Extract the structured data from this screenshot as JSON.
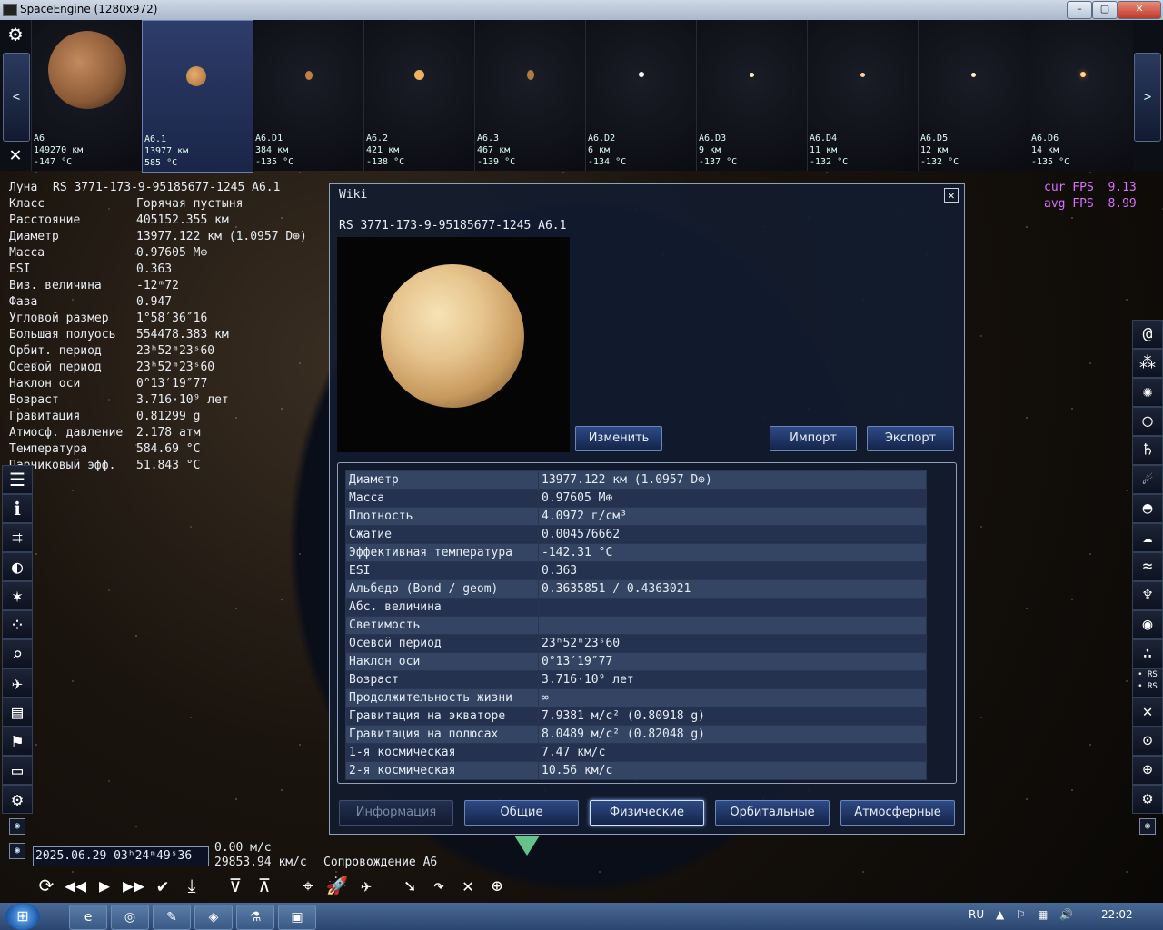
{
  "window": {
    "title": "SpaceEngine (1280x972)",
    "min": "–",
    "max": "▢",
    "close": "✕"
  },
  "strip": {
    "prev": "<",
    "next": ">",
    "thumbs": [
      {
        "name": "A6",
        "size": "149270 км",
        "temp": "-147 °C"
      },
      {
        "name": "A6.1",
        "size": "13977 км",
        "temp": "585 °C"
      },
      {
        "name": "A6.D1",
        "size": "384 км",
        "temp": "-135 °C"
      },
      {
        "name": "A6.2",
        "size": "421 км",
        "temp": "-138 °C"
      },
      {
        "name": "A6.3",
        "size": "467 км",
        "temp": "-139 °C"
      },
      {
        "name": "A6.D2",
        "size": "6 км",
        "temp": "-134 °C"
      },
      {
        "name": "A6.D3",
        "size": "9 км",
        "temp": "-137 °C"
      },
      {
        "name": "A6.D4",
        "size": "11 км",
        "temp": "-132 °C"
      },
      {
        "name": "A6.D5",
        "size": "12 км",
        "temp": "-132 °C"
      },
      {
        "name": "A6.D6",
        "size": "14 км",
        "temp": "-135 °C"
      }
    ]
  },
  "info": [
    {
      "k": "Луна",
      "v": "RS 3771-173-9-95185677-1245 A6.1"
    },
    {
      "k": "Класс",
      "v": "Горячая пустыня"
    },
    {
      "k": "Расстояние",
      "v": "405152.355 км"
    },
    {
      "k": "Диаметр",
      "v": "13977.122 км (1.0957 D⊕)"
    },
    {
      "k": "Масса",
      "v": "0.97605 M⊕"
    },
    {
      "k": "ESI",
      "v": "0.363"
    },
    {
      "k": "Виз. величина",
      "v": "-12ᵐ72"
    },
    {
      "k": "Фаза",
      "v": "0.947"
    },
    {
      "k": "Угловой размер",
      "v": "1°58′36″16"
    },
    {
      "k": "Большая полуось",
      "v": "554478.383 км"
    },
    {
      "k": "Орбит. период",
      "v": "23ʰ52ᵐ23ˢ60"
    },
    {
      "k": "Осевой период",
      "v": "23ʰ52ᵐ23ˢ60"
    },
    {
      "k": "Наклон оси",
      "v": "0°13′19″77"
    },
    {
      "k": "Возраст",
      "v": "3.716·10⁹ лет"
    },
    {
      "k": "Гравитация",
      "v": "0.81299 g"
    },
    {
      "k": "Атмосф. давление",
      "v": "2.178 атм"
    },
    {
      "k": "Температура",
      "v": "584.69 °C"
    },
    {
      "k": "Парниковый эфф.",
      "v": "51.843 °C"
    }
  ],
  "fps": {
    "cur_label": "cur FPS",
    "cur": "9.13",
    "avg_label": "avg FPS",
    "avg": "8.99"
  },
  "wiki": {
    "title": "Wiki",
    "object_name": "RS 3771-173-9-95185677-1245 A6.1",
    "btn_edit": "Изменить",
    "btn_import": "Импорт",
    "btn_export": "Экспорт",
    "props": [
      {
        "k": "Диаметр",
        "v": "13977.122 км (1.0957 D⊕)"
      },
      {
        "k": "Масса",
        "v": "0.97605 M⊕"
      },
      {
        "k": "Плотность",
        "v": "4.0972 г/см³"
      },
      {
        "k": "Сжатие",
        "v": "0.004576662"
      },
      {
        "k": "Эффективная температура",
        "v": "-142.31 °C"
      },
      {
        "k": "ESI",
        "v": "0.363"
      },
      {
        "k": "Альбедо (Bond / geom)",
        "v": "0.3635851 / 0.4363021"
      },
      {
        "k": "Абс. величина",
        "v": ""
      },
      {
        "k": "Светимость",
        "v": ""
      },
      {
        "k": "Осевой период",
        "v": "23ʰ52ᵐ23ˢ60"
      },
      {
        "k": "Наклон оси",
        "v": "0°13′19″77"
      },
      {
        "k": "Возраст",
        "v": "3.716·10⁹ лет"
      },
      {
        "k": "Продолжительность жизни",
        "v": "∞"
      },
      {
        "k": "Гравитация на экваторе",
        "v": "7.9381 м/с² (0.80918 g)"
      },
      {
        "k": "Гравитация на полюсах",
        "v": "8.0489 м/с² (0.82048 g)"
      },
      {
        "k": "1-я космическая",
        "v": "7.47 км/с"
      },
      {
        "k": "2-я космическая",
        "v": "10.56 км/с"
      }
    ],
    "tabs": [
      {
        "label": "Информация",
        "state": "disabled"
      },
      {
        "label": "Общие",
        "state": "normal"
      },
      {
        "label": "Физические",
        "state": "active"
      },
      {
        "label": "Орбитальные",
        "state": "normal"
      },
      {
        "label": "Атмосферные",
        "state": "normal"
      }
    ]
  },
  "bottom": {
    "datetime": "2025.06.29 03ʰ24ᵐ49ˢ36",
    "speed1": "0.00 м/с",
    "speed2": "29853.94 км/с",
    "follow": "Сопровождение A6"
  },
  "taskbar": {
    "lang": "RU",
    "time": "22:02"
  }
}
